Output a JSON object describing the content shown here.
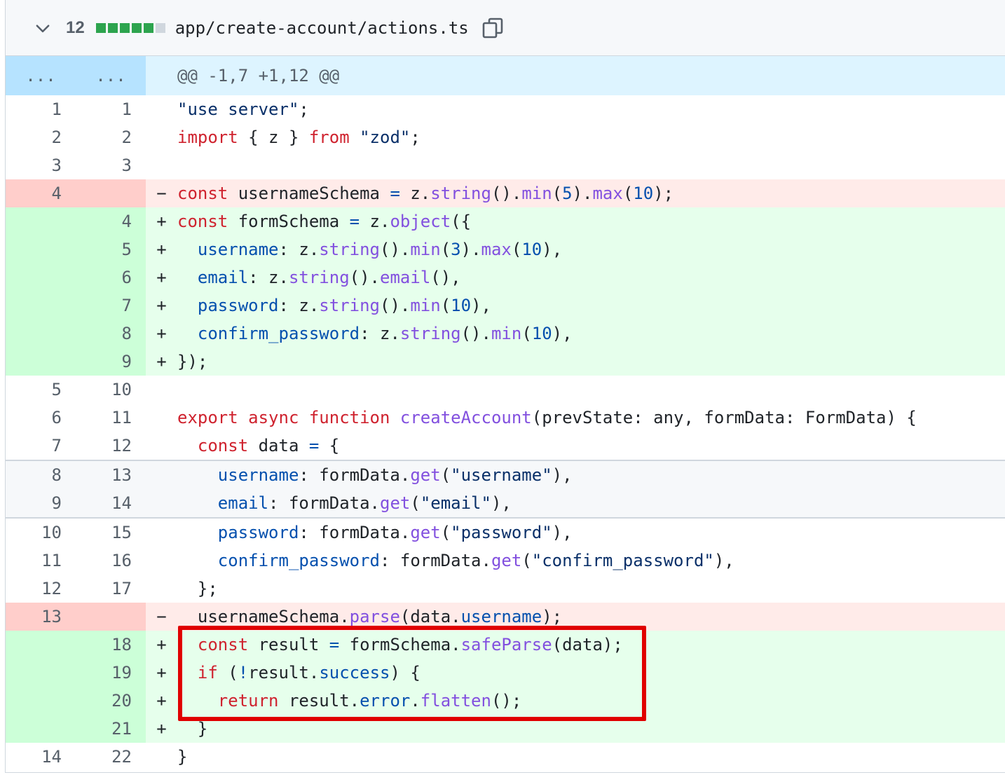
{
  "file": {
    "changes_count": "12",
    "path": "app/create-account/actions.ts",
    "diffstat": [
      "add",
      "add",
      "add",
      "add",
      "add",
      "neutral"
    ]
  },
  "hunk": {
    "left_expand": "...",
    "right_expand": "...",
    "header": "@@ -1,7 +1,12 @@"
  },
  "lines": [
    {
      "type": "ctx",
      "old": "1",
      "new": "1",
      "tokens": [
        [
          "str",
          "\"use server\""
        ],
        [
          "t",
          ";"
        ]
      ]
    },
    {
      "type": "ctx",
      "old": "2",
      "new": "2",
      "tokens": [
        [
          "kw",
          "import"
        ],
        [
          "t",
          " { z } "
        ],
        [
          "kw",
          "from"
        ],
        [
          "t",
          " "
        ],
        [
          "str",
          "\"zod\""
        ],
        [
          "t",
          ";"
        ]
      ]
    },
    {
      "type": "ctx",
      "old": "3",
      "new": "3",
      "tokens": []
    },
    {
      "type": "del",
      "old": "4",
      "new": "",
      "marker": "−",
      "tokens": [
        [
          "kw",
          "const"
        ],
        [
          "t",
          " usernameSchema "
        ],
        [
          "op",
          "="
        ],
        [
          "t",
          " z."
        ],
        [
          "fn",
          "string"
        ],
        [
          "t",
          "()."
        ],
        [
          "fn",
          "min"
        ],
        [
          "t",
          "("
        ],
        [
          "num",
          "5"
        ],
        [
          "t",
          ")."
        ],
        [
          "fn",
          "max"
        ],
        [
          "t",
          "("
        ],
        [
          "num",
          "10"
        ],
        [
          "t",
          ");"
        ]
      ]
    },
    {
      "type": "add",
      "old": "",
      "new": "4",
      "marker": "+",
      "tokens": [
        [
          "kw",
          "const"
        ],
        [
          "t",
          " formSchema "
        ],
        [
          "op",
          "="
        ],
        [
          "t",
          " z."
        ],
        [
          "fn",
          "object"
        ],
        [
          "t",
          "({"
        ]
      ]
    },
    {
      "type": "add",
      "old": "",
      "new": "5",
      "marker": "+",
      "tokens": [
        [
          "t",
          "  "
        ],
        [
          "prop",
          "username"
        ],
        [
          "t",
          ": z."
        ],
        [
          "fn",
          "string"
        ],
        [
          "t",
          "()."
        ],
        [
          "fn",
          "min"
        ],
        [
          "t",
          "("
        ],
        [
          "num",
          "3"
        ],
        [
          "t",
          ")."
        ],
        [
          "fn",
          "max"
        ],
        [
          "t",
          "("
        ],
        [
          "num",
          "10"
        ],
        [
          "t",
          "),"
        ]
      ]
    },
    {
      "type": "add",
      "old": "",
      "new": "6",
      "marker": "+",
      "tokens": [
        [
          "t",
          "  "
        ],
        [
          "prop",
          "email"
        ],
        [
          "t",
          ": z."
        ],
        [
          "fn",
          "string"
        ],
        [
          "t",
          "()."
        ],
        [
          "fn",
          "email"
        ],
        [
          "t",
          "(),"
        ]
      ]
    },
    {
      "type": "add",
      "old": "",
      "new": "7",
      "marker": "+",
      "tokens": [
        [
          "t",
          "  "
        ],
        [
          "prop",
          "password"
        ],
        [
          "t",
          ": z."
        ],
        [
          "fn",
          "string"
        ],
        [
          "t",
          "()."
        ],
        [
          "fn",
          "min"
        ],
        [
          "t",
          "("
        ],
        [
          "num",
          "10"
        ],
        [
          "t",
          "),"
        ]
      ]
    },
    {
      "type": "add",
      "old": "",
      "new": "8",
      "marker": "+",
      "tokens": [
        [
          "t",
          "  "
        ],
        [
          "prop",
          "confirm_password"
        ],
        [
          "t",
          ": z."
        ],
        [
          "fn",
          "string"
        ],
        [
          "t",
          "()."
        ],
        [
          "fn",
          "min"
        ],
        [
          "t",
          "("
        ],
        [
          "num",
          "10"
        ],
        [
          "t",
          "),"
        ]
      ]
    },
    {
      "type": "add",
      "old": "",
      "new": "9",
      "marker": "+",
      "tokens": [
        [
          "t",
          "});"
        ]
      ]
    },
    {
      "type": "ctx",
      "old": "5",
      "new": "10",
      "tokens": []
    },
    {
      "type": "ctx",
      "old": "6",
      "new": "11",
      "tokens": [
        [
          "kw",
          "export"
        ],
        [
          "t",
          " "
        ],
        [
          "kw",
          "async"
        ],
        [
          "t",
          " "
        ],
        [
          "kw",
          "function"
        ],
        [
          "t",
          " "
        ],
        [
          "fn",
          "createAccount"
        ],
        [
          "t",
          "(prevState: any, formData: FormData) {"
        ]
      ]
    },
    {
      "type": "ctx",
      "old": "7",
      "new": "12",
      "tokens": [
        [
          "t",
          "  "
        ],
        [
          "kw",
          "const"
        ],
        [
          "t",
          " data "
        ],
        [
          "op",
          "="
        ],
        [
          "t",
          " {"
        ]
      ]
    },
    {
      "type": "ctxg",
      "old": "8",
      "new": "13",
      "tokens": [
        [
          "t",
          "    "
        ],
        [
          "prop",
          "username"
        ],
        [
          "t",
          ": formData."
        ],
        [
          "fn",
          "get"
        ],
        [
          "t",
          "("
        ],
        [
          "str",
          "\"username\""
        ],
        [
          "t",
          "),"
        ]
      ]
    },
    {
      "type": "ctxg",
      "old": "9",
      "new": "14",
      "tokens": [
        [
          "t",
          "    "
        ],
        [
          "prop",
          "email"
        ],
        [
          "t",
          ": formData."
        ],
        [
          "fn",
          "get"
        ],
        [
          "t",
          "("
        ],
        [
          "str",
          "\"email\""
        ],
        [
          "t",
          "),"
        ]
      ]
    },
    {
      "type": "ctx",
      "old": "10",
      "new": "15",
      "sep": true,
      "tokens": [
        [
          "t",
          "    "
        ],
        [
          "prop",
          "password"
        ],
        [
          "t",
          ": formData."
        ],
        [
          "fn",
          "get"
        ],
        [
          "t",
          "("
        ],
        [
          "str",
          "\"password\""
        ],
        [
          "t",
          "),"
        ]
      ]
    },
    {
      "type": "ctx",
      "old": "11",
      "new": "16",
      "tokens": [
        [
          "t",
          "    "
        ],
        [
          "prop",
          "confirm_password"
        ],
        [
          "t",
          ": formData."
        ],
        [
          "fn",
          "get"
        ],
        [
          "t",
          "("
        ],
        [
          "str",
          "\"confirm_password\""
        ],
        [
          "t",
          "),"
        ]
      ]
    },
    {
      "type": "ctx",
      "old": "12",
      "new": "17",
      "tokens": [
        [
          "t",
          "  };"
        ]
      ]
    },
    {
      "type": "del",
      "old": "13",
      "new": "",
      "marker": "−",
      "tokens": [
        [
          "t",
          "  usernameSchema."
        ],
        [
          "fn",
          "parse"
        ],
        [
          "t",
          "(data."
        ],
        [
          "prop",
          "username"
        ],
        [
          "t",
          ");"
        ]
      ]
    },
    {
      "type": "add",
      "old": "",
      "new": "18",
      "marker": "+",
      "tokens": [
        [
          "t",
          "  "
        ],
        [
          "kw",
          "const"
        ],
        [
          "t",
          " result "
        ],
        [
          "op",
          "="
        ],
        [
          "t",
          " formSchema."
        ],
        [
          "fn",
          "safeParse"
        ],
        [
          "t",
          "(data);"
        ]
      ]
    },
    {
      "type": "add",
      "old": "",
      "new": "19",
      "marker": "+",
      "tokens": [
        [
          "t",
          "  "
        ],
        [
          "kw",
          "if"
        ],
        [
          "t",
          " ("
        ],
        [
          "op",
          "!"
        ],
        [
          "t",
          "result."
        ],
        [
          "prop",
          "success"
        ],
        [
          "t",
          ") {"
        ]
      ]
    },
    {
      "type": "add",
      "old": "",
      "new": "20",
      "marker": "+",
      "tokens": [
        [
          "t",
          "    "
        ],
        [
          "kw",
          "return"
        ],
        [
          "t",
          " result."
        ],
        [
          "prop",
          "error"
        ],
        [
          "t",
          "."
        ],
        [
          "fn",
          "flatten"
        ],
        [
          "t",
          "();"
        ]
      ]
    },
    {
      "type": "add",
      "old": "",
      "new": "21",
      "marker": "+",
      "tokens": [
        [
          "t",
          "  }"
        ]
      ]
    },
    {
      "type": "ctx",
      "old": "14",
      "new": "22",
      "tokens": [
        [
          "t",
          "}"
        ]
      ]
    }
  ]
}
